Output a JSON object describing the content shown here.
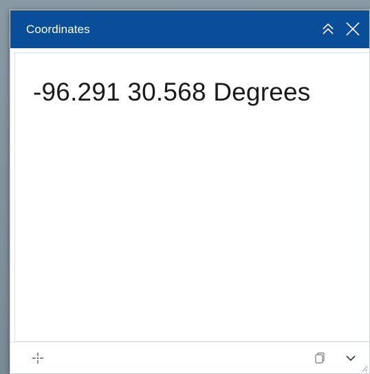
{
  "panel": {
    "title": "Coordinates",
    "accent_color": "#0a4d99"
  },
  "header": {
    "icons": [
      "double-chevron-up-icon",
      "close-icon"
    ]
  },
  "display": {
    "coordinates_text": "-96.291 30.568 Degrees"
  },
  "footer": {
    "icons": [
      "crosshair-icon",
      "copy-icon",
      "chevron-down-icon"
    ]
  }
}
